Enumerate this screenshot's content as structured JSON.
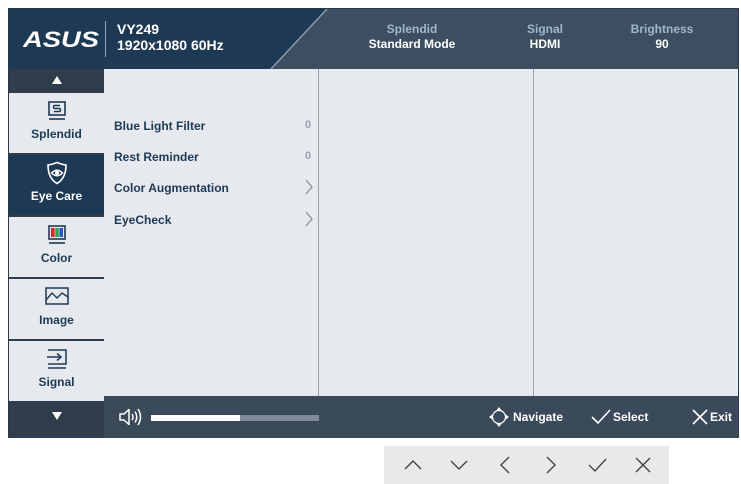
{
  "header": {
    "logo": "ASUS",
    "model": "VY249",
    "resolution": "1920x1080 60Hz",
    "stats": [
      {
        "label": "Splendid",
        "value": "Standard Mode"
      },
      {
        "label": "Signal",
        "value": "HDMI"
      },
      {
        "label": "Brightness",
        "value": "90"
      }
    ]
  },
  "sidebar": {
    "up_icon": "triangle-up-icon",
    "down_icon": "triangle-down-icon",
    "items": [
      {
        "label": "Splendid",
        "icon": "splendid-icon",
        "active": false
      },
      {
        "label": "Eye Care",
        "icon": "eye-icon",
        "active": true
      },
      {
        "label": "Color",
        "icon": "color-bars-icon",
        "active": false
      },
      {
        "label": "Image",
        "icon": "image-wave-icon",
        "active": false
      },
      {
        "label": "Signal",
        "icon": "signal-input-icon",
        "active": false
      }
    ]
  },
  "menu": {
    "items": [
      {
        "label": "Blue Light Filter",
        "value": "0"
      },
      {
        "label": "Rest Reminder",
        "value": "0"
      },
      {
        "label": "Color Augmentation",
        "value": null,
        "icon": "chevron-right-icon"
      },
      {
        "label": "EyeCheck",
        "value": null,
        "icon": "chevron-right-icon"
      }
    ]
  },
  "bottom": {
    "volume_icon": "speaker-icon",
    "volume_fraction": 0.53,
    "hints": [
      {
        "icon": "navigate-icon",
        "label": "Navigate"
      },
      {
        "icon": "check-icon",
        "label": "Select"
      },
      {
        "icon": "close-icon",
        "label": "Exit"
      }
    ]
  },
  "keys": [
    "chevron-up-icon",
    "chevron-down-icon",
    "chevron-left-icon",
    "chevron-right-icon",
    "check-icon",
    "close-icon"
  ],
  "colors": {
    "header_dark": "#1e3954",
    "header": "#3d4e60",
    "panel": "#e6e9ee",
    "active_item": "#1e3954",
    "stat_label": "#9fb6cd"
  }
}
